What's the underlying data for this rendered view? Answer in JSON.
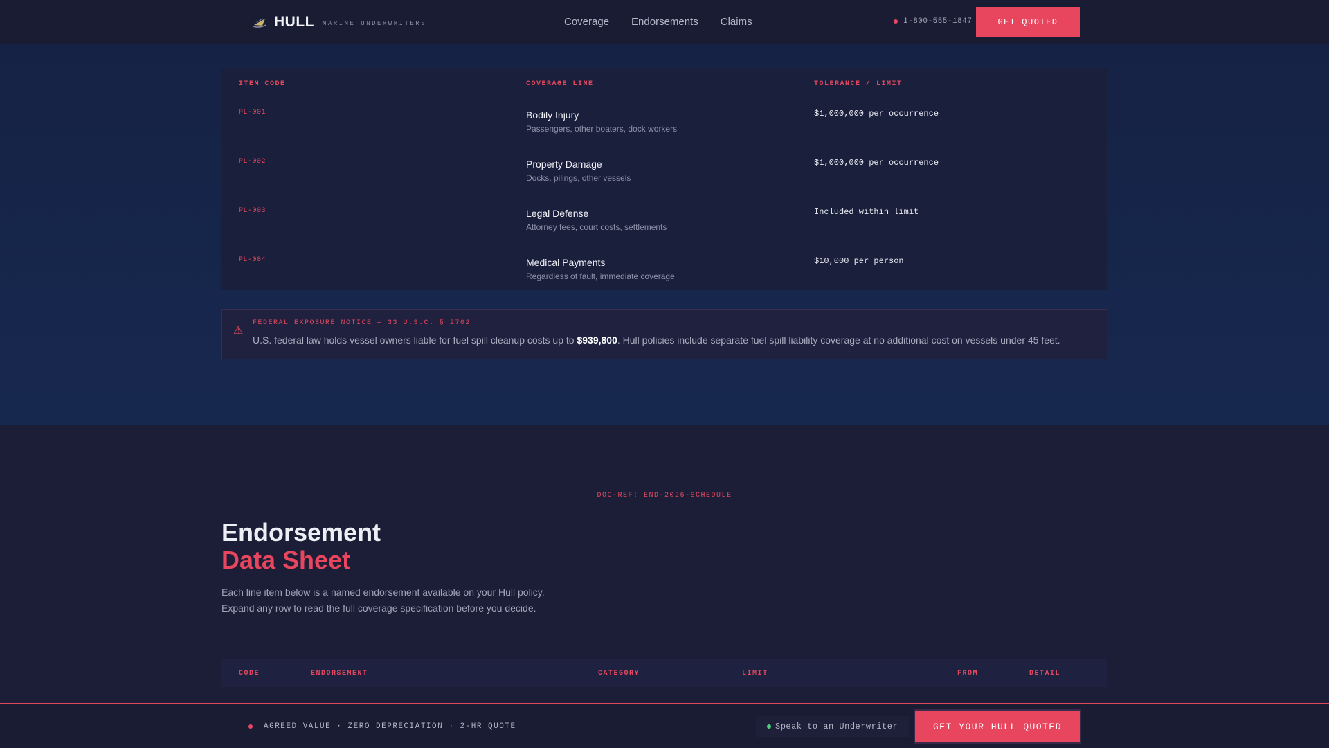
{
  "header": {
    "brand": "HULL",
    "brand_sub": "MARINE UNDERWRITERS",
    "nav": [
      "Coverage",
      "Endorsements",
      "Claims"
    ],
    "phone": "1-800-555-1847",
    "cta": "GET QUOTED"
  },
  "coverage_table": {
    "headers": [
      "ITEM CODE",
      "COVERAGE LINE",
      "TOLERANCE / LIMIT"
    ],
    "rows": [
      {
        "code": "PL-001",
        "title": "Bodily Injury",
        "desc": "Passengers, other boaters, dock workers",
        "limit": "$1,000,000 per occurrence"
      },
      {
        "code": "PL-002",
        "title": "Property Damage",
        "desc": "Docks, pilings, other vessels",
        "limit": "$1,000,000 per occurrence"
      },
      {
        "code": "PL-003",
        "title": "Legal Defense",
        "desc": "Attorney fees, court costs, settlements",
        "limit": "Included within limit"
      },
      {
        "code": "PL-004",
        "title": "Medical Payments",
        "desc": "Regardless of fault, immediate coverage",
        "limit": "$10,000 per person"
      }
    ]
  },
  "notice": {
    "heading": "FEDERAL EXPOSURE NOTICE — 33 U.S.C. § 2702",
    "body_pre": "U.S. federal law holds vessel owners liable for fuel spill cleanup costs up to ",
    "amount": "$939,800",
    "body_post": ". Hull policies include separate fuel spill liability coverage at no additional cost on vessels under 45 feet."
  },
  "endorsements": {
    "doc_ref": "DOC-REF: END-2026-SCHEDULE",
    "title_line1": "Endorsement",
    "title_line2": "Data Sheet",
    "desc_line1": "Each line item below is a named endorsement available on your Hull policy.",
    "desc_line2": "Expand any row to read the full coverage specification before you decide.",
    "headers": [
      "CODE",
      "ENDORSEMENT",
      "CATEGORY",
      "LIMIT",
      "FROM",
      "DETAIL"
    ]
  },
  "bottom_bar": {
    "tagline": "AGREED VALUE · ZERO DEPRECIATION · 2-HR QUOTE",
    "speak": "Speak to an Underwriter",
    "cta": "GET YOUR HULL QUOTED"
  },
  "colors": {
    "accent": "#e8455f",
    "background": "#1b1e36",
    "upper_background": "#17284f",
    "online": "#4cd07a"
  }
}
